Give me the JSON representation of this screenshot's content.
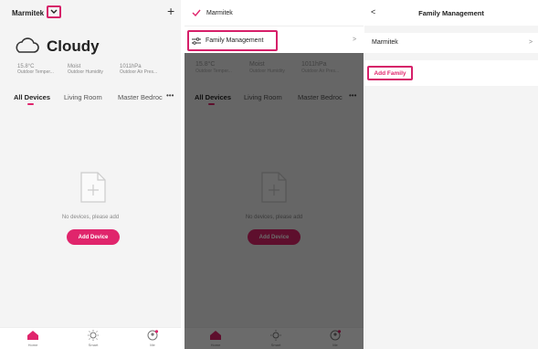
{
  "home": {
    "family_name": "Marmitek",
    "weather": "Cloudy",
    "stats": [
      {
        "value": "15.8°C",
        "label": "Outdoor Temper..."
      },
      {
        "value": "Moist",
        "label": "Outdoor Humidity"
      },
      {
        "value": "1011hPa",
        "label": "Outdoor Air Pres..."
      }
    ],
    "tabs": [
      "All Devices",
      "Living Room",
      "Master Bedroc"
    ],
    "more": "•••",
    "empty_text": "No devices, please add",
    "add_device": "Add Device",
    "nav": [
      "Home",
      "Smart",
      "Me"
    ]
  },
  "menu": {
    "family_check": "Marmitek",
    "family_management": "Family Management",
    "chevron": ">"
  },
  "family_mgmt": {
    "title": "Family Management",
    "back": "<",
    "family_item": "Marmitek",
    "add_family": "Add Family"
  },
  "colors": {
    "accent": "#e0256c",
    "highlight": "#d61f69"
  }
}
